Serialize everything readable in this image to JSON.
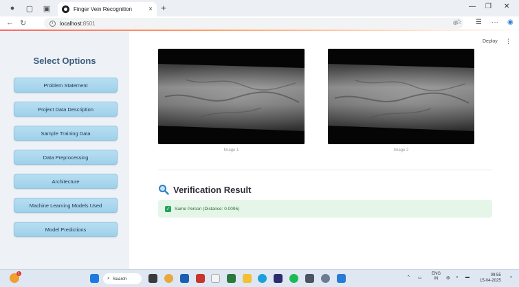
{
  "browser": {
    "tab_title": "Finger Vein Recognition",
    "tab_close": "×",
    "new_tab": "+",
    "url_host": "localhost",
    "url_port": ":8501"
  },
  "app": {
    "deploy_label": "Deploy",
    "sidebar_title": "Select Options",
    "menu": [
      "Problem Statement",
      "Project Data Description",
      "Sample Training Data",
      "Data Preprocessing",
      "Architecture",
      "Machine Learning Models Used",
      "Model Predictions"
    ],
    "images": [
      {
        "caption": "Image 1"
      },
      {
        "caption": "Image 2"
      }
    ],
    "result_heading": "Verification Result",
    "result_message": "Same Person (Distance: 0.0095)"
  },
  "taskbar": {
    "weather_badge": "1",
    "search_label": "Search",
    "lang_line1": "ENG",
    "lang_line2": "IN",
    "time": "09:55",
    "date": "15-04-2025"
  },
  "colors": {
    "sidebar_bg": "#eef2f6",
    "button_bg": "#9fd1ea",
    "success_bg": "#e5f6e9",
    "success_icon": "#21a35a"
  },
  "icons": {
    "tab_favicon": "streamlit-logo-icon",
    "result_heading": "magnifier-icon",
    "alert": "check-box-icon"
  }
}
